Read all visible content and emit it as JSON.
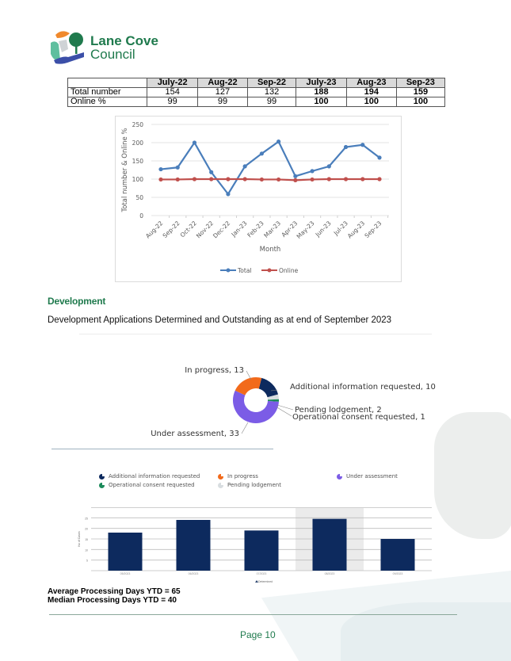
{
  "header": {
    "logo_line1": "Lane Cove",
    "logo_line2": "Council"
  },
  "stats_table": {
    "columns": [
      "",
      "July-22",
      "Aug-22",
      "Sep-22",
      "July-23",
      "Aug-23",
      "Sep-23"
    ],
    "rows": [
      {
        "label": "Total number",
        "values": [
          "154",
          "127",
          "132",
          "188",
          "194",
          "159"
        ]
      },
      {
        "label": "Online %",
        "values": [
          "99",
          "99",
          "99",
          "100",
          "100",
          "100"
        ]
      }
    ],
    "bold_from_index": 3
  },
  "chart_data": [
    {
      "type": "line",
      "title": "",
      "xlabel": "Month",
      "ylabel": "Total number & Online %",
      "ylim": [
        0,
        250
      ],
      "yticks": [
        0,
        50,
        100,
        150,
        200,
        250
      ],
      "grid": true,
      "legend_placement": "bottom",
      "categories": [
        "Aug-22",
        "Sep-22",
        "Oct-22",
        "Nov-22",
        "Dec-22",
        "Jan-23",
        "Feb-23",
        "Mar-23",
        "Apr-23",
        "May-23",
        "Jun-23",
        "Jul-23",
        "Aug-23",
        "Sep-23"
      ],
      "series": [
        {
          "name": "Total",
          "color": "#4a7ebb",
          "values": [
            127,
            132,
            200,
            119,
            59,
            135,
            170,
            203,
            108,
            122,
            135,
            188,
            194,
            159
          ]
        },
        {
          "name": "Online",
          "color": "#c0504d",
          "values": [
            99,
            99,
            100,
            100,
            100,
            100,
            99,
            99,
            97,
            99,
            100,
            100,
            100,
            100
          ]
        }
      ]
    },
    {
      "type": "pie",
      "subtype": "donut",
      "title": "",
      "slices": [
        {
          "label": "Additional information requested",
          "value": 10,
          "color": "#0d2a5e",
          "display": "Additional information requested, 10"
        },
        {
          "label": "Pending lodgement",
          "value": 2,
          "color": "#d8dde0",
          "display": "Pending lodgement, 2"
        },
        {
          "label": "Operational consent requested",
          "value": 1,
          "color": "#1b8a5a",
          "display": "Operational consent requested, 1"
        },
        {
          "label": "Under assessment",
          "value": 33,
          "color": "#7b5ce6",
          "display": "Under assessment, 33"
        },
        {
          "label": "In progress",
          "value": 13,
          "color": "#f26a1b",
          "display": "In progress, 13"
        }
      ],
      "legend": [
        {
          "label": "Additional information requested",
          "color": "#0d2a5e"
        },
        {
          "label": "In progress",
          "color": "#f26a1b"
        },
        {
          "label": "Under assessment",
          "color": "#7b5ce6"
        },
        {
          "label": "Operational consent requested",
          "color": "#1b8a5a"
        },
        {
          "label": "Pending lodgement",
          "color": "#d8dde0"
        }
      ]
    },
    {
      "type": "bar",
      "title": "",
      "xlabel": "",
      "ylabel": "No of Cases",
      "ylim": [
        0,
        30
      ],
      "yticks": [
        5,
        10,
        15,
        20,
        25
      ],
      "grid": true,
      "categories": [
        "05/2023",
        "06/2023",
        "07/2023",
        "08/2023",
        "09/2023"
      ],
      "series": [
        {
          "name": "Determined",
          "color": "#0d2a5e",
          "values": [
            18,
            24,
            19,
            24.5,
            15
          ]
        }
      ],
      "highlight_index": 3,
      "legend_placement": "bottom"
    }
  ],
  "development": {
    "heading": "Development",
    "subtitle": "Development Applications Determined and Outstanding as at end of September 2023",
    "avg_days": "Average Processing Days YTD =  65",
    "median_days": "Median Processing Days YTD =  40"
  },
  "footer": {
    "page": "Page 10"
  }
}
